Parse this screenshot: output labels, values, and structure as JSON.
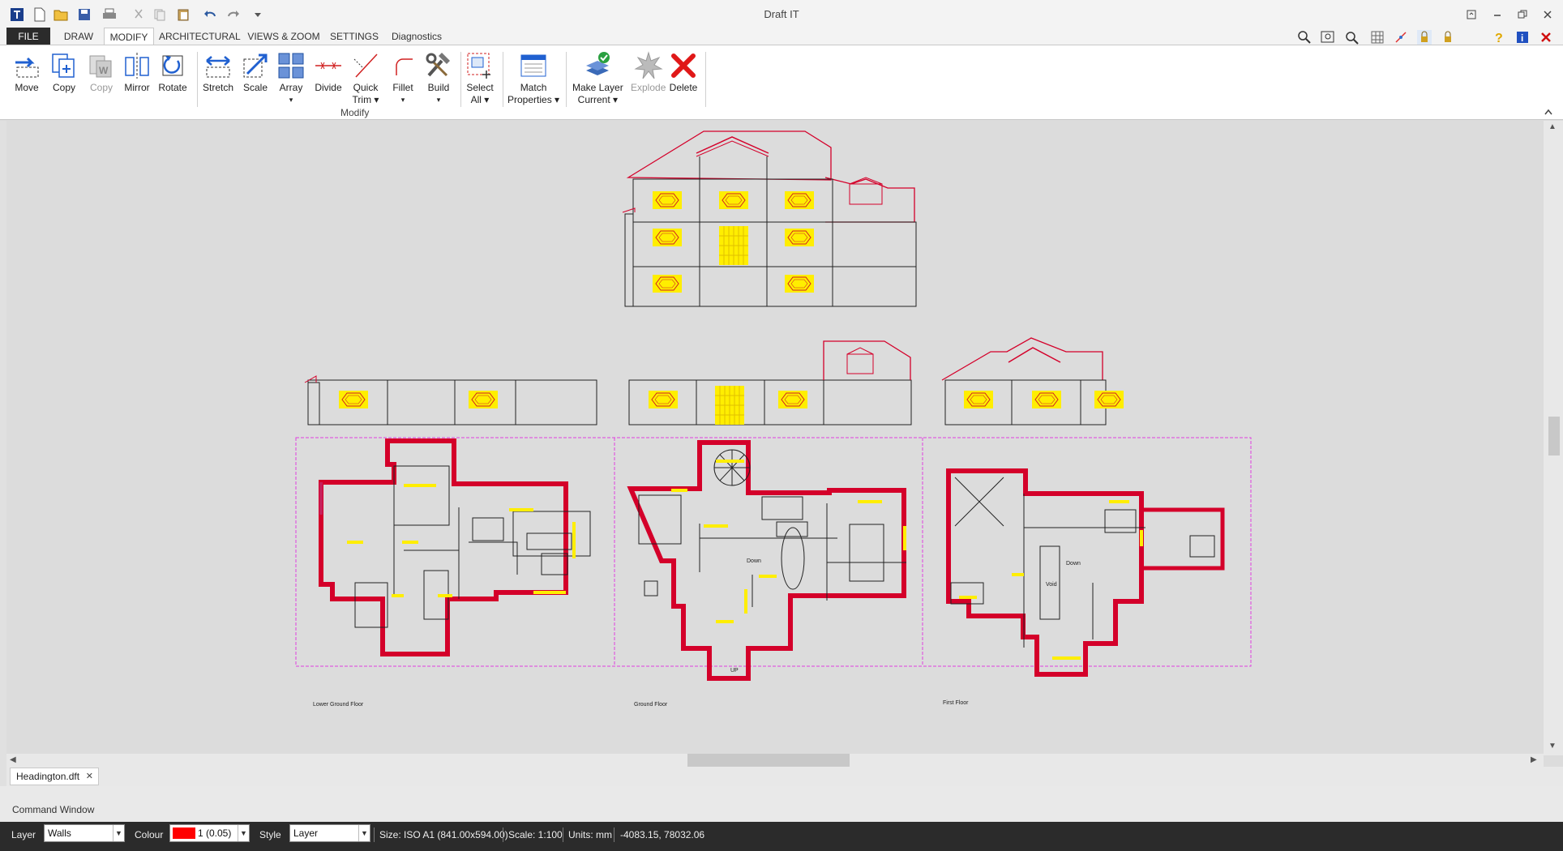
{
  "window": {
    "title": "Draft IT"
  },
  "tabs": [
    {
      "label": "FILE"
    },
    {
      "label": "DRAW"
    },
    {
      "label": "MODIFY"
    },
    {
      "label": "ARCHITECTURAL"
    },
    {
      "label": "VIEWS & ZOOM"
    },
    {
      "label": "SETTINGS"
    },
    {
      "label": "Diagnostics"
    }
  ],
  "ribbon": {
    "group_label": "Modify",
    "buttons": [
      {
        "label": "Move"
      },
      {
        "label": "Copy"
      },
      {
        "label": "Copy"
      },
      {
        "label": "Mirror"
      },
      {
        "label": "Rotate"
      },
      {
        "label": "Stretch"
      },
      {
        "label": "Scale"
      },
      {
        "label": "Array",
        "label2": "▾"
      },
      {
        "label": "Divide"
      },
      {
        "label": "Quick",
        "label2": "Trim ▾"
      },
      {
        "label": "Fillet",
        "label2": "▾"
      },
      {
        "label": "Build",
        "label2": "▾"
      },
      {
        "label": "Select",
        "label2": "All ▾"
      },
      {
        "label": "Match",
        "label2": "Properties ▾"
      },
      {
        "label": "Make Layer",
        "label2": "Current ▾"
      },
      {
        "label": "Explode"
      },
      {
        "label": "Delete"
      }
    ]
  },
  "drawing": {
    "sheet_labels": {
      "lower": "Lower Ground Floor",
      "ground": "Ground Floor",
      "first": "First Floor"
    },
    "room_labels": {
      "down1": "Down",
      "up": "UP",
      "down2": "Down",
      "void": "Void"
    }
  },
  "document_tab": {
    "name": "Headington.dft",
    "close": "✕"
  },
  "command_window": {
    "label": "Command Window"
  },
  "status": {
    "layer_label": "Layer",
    "layer_value": "Walls",
    "colour_label": "Colour",
    "colour_value": "1 (0.05)",
    "colour_swatch": "#ff0000",
    "style_label": "Style",
    "style_value": "Layer",
    "size": "Size: ISO A1 (841.00x594.00)",
    "scale": "Scale: 1:100",
    "units": "Units: mm",
    "coords": "-4083.15, 78032.06"
  },
  "colors": {
    "wall": "#d4002a",
    "wall_hatch": "#c8205a",
    "window": "#ffee00",
    "sheet_border": "#e040e0",
    "line": "#222222"
  }
}
